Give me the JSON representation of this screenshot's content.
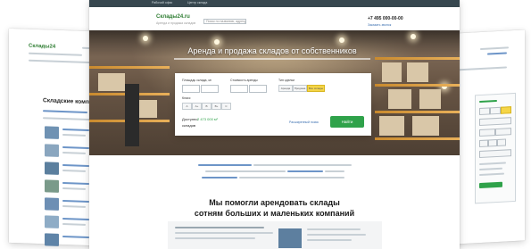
{
  "main": {
    "topbar": {
      "left": "Рабочий офис",
      "middle": "Центр склада"
    },
    "header": {
      "logo": "Склады24.ru",
      "tagline": "Аренда и продажа складов",
      "search_placeholder": "Поиск по названию, адресу",
      "phone": "+7 495 000-00-00",
      "callback": "Заказать звонок"
    },
    "hero": {
      "title": "Аренда и продажа складов от собственников"
    },
    "form": {
      "label_area": "Площадь склада, м²",
      "label_price": "Стоимость аренды",
      "label_deal": "Тип сделки",
      "label_class": "Класс",
      "deal_chips": [
        "Аренда",
        "Продажа",
        "Все склады"
      ],
      "class_chips": [
        "A",
        "A+",
        "B",
        "B+",
        "C"
      ],
      "result_label": "Доступно",
      "result_count": "2 473 000 м²",
      "result_tail": "складов",
      "more_link": "Расширенный поиск",
      "find_button": "Найти"
    },
    "headline_1": "Мы помогли арендовать склады",
    "headline_2": "сотням больших и маленьких компаний"
  },
  "left_page": {
    "logo": "Склады24",
    "heading": "Складские комплексы"
  },
  "colors": {
    "accent_green": "#2fa24a",
    "chip_yellow": "#f5d547",
    "topbar": "#37474f",
    "link_blue": "#3a6fb0"
  }
}
